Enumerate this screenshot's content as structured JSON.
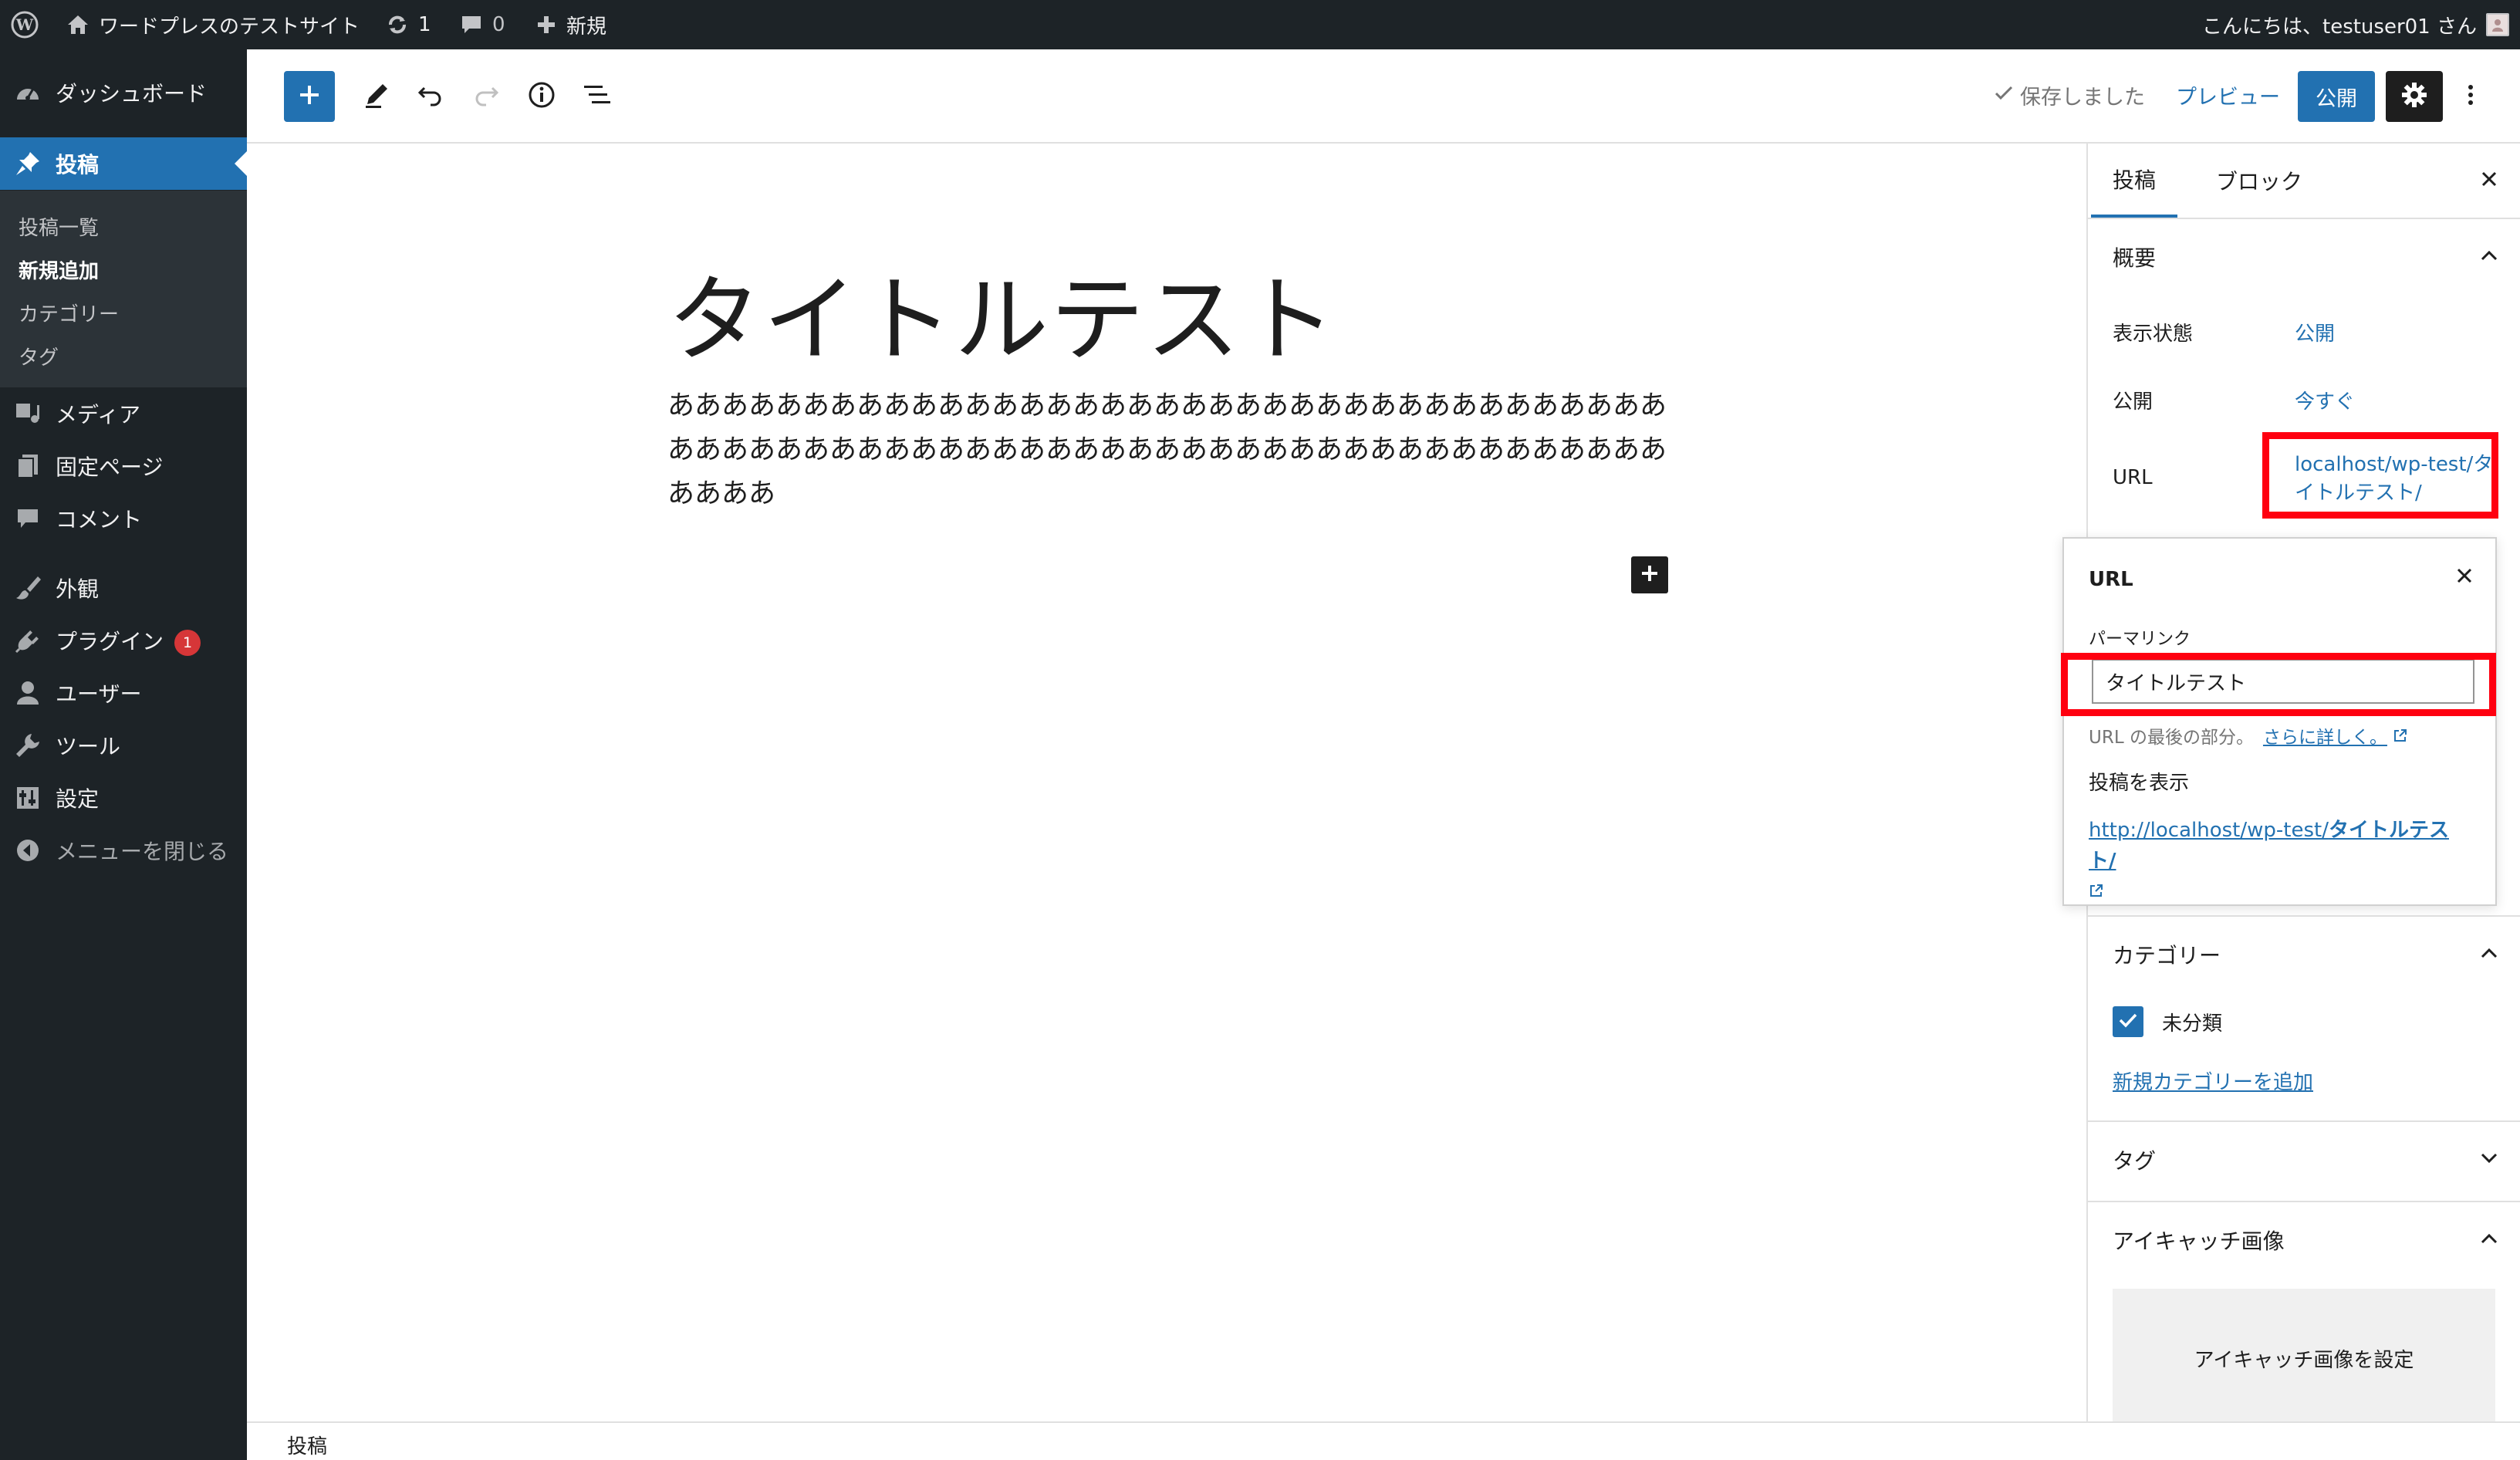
{
  "admin_bar": {
    "site_name": "ワードプレスのテストサイト",
    "updates_count": "1",
    "comments_count": "0",
    "new_label": "新規",
    "greeting": "こんにちは、testuser01 さん"
  },
  "sidebar": {
    "items": [
      {
        "label": "ダッシュボード",
        "icon": "dashboard-icon"
      },
      {
        "label": "投稿",
        "icon": "pushpin-icon",
        "current": true
      },
      {
        "label": "メディア",
        "icon": "media-icon"
      },
      {
        "label": "固定ページ",
        "icon": "page-icon"
      },
      {
        "label": "コメント",
        "icon": "comment-icon"
      },
      {
        "label": "外観",
        "icon": "brush-icon"
      },
      {
        "label": "プラグイン",
        "icon": "plugin-icon",
        "badge": "1"
      },
      {
        "label": "ユーザー",
        "icon": "user-icon"
      },
      {
        "label": "ツール",
        "icon": "wrench-icon"
      },
      {
        "label": "設定",
        "icon": "settings-sliders-icon"
      },
      {
        "label": "メニューを閉じる",
        "icon": "collapse-icon"
      }
    ],
    "submenu": [
      {
        "label": "投稿一覧"
      },
      {
        "label": "新規追加",
        "active": true
      },
      {
        "label": "カテゴリー"
      },
      {
        "label": "タグ"
      }
    ]
  },
  "toolbar": {
    "saved_label": "保存しました",
    "preview_label": "プレビュー",
    "publish_label": "公開"
  },
  "editor": {
    "title": "タイトルテスト",
    "body": "ああああああああああああああああああああああああああああああああああああああああああああああああああああああああああああああああああああああああああああああ"
  },
  "settings": {
    "tabs": [
      "投稿",
      "ブロック"
    ],
    "summary": {
      "heading": "概要",
      "visibility_label": "表示状態",
      "visibility_value": "公開",
      "publish_label": "公開",
      "publish_value": "今すぐ",
      "url_label": "URL",
      "url_value": "localhost/wp-test/タイトルテスト/"
    },
    "url_popover": {
      "title": "URL",
      "permalink_label": "パーマリンク",
      "permalink_value": "タイトルテスト",
      "help_text": "URL の最後の部分。",
      "help_link": "さらに詳しく。",
      "view_post_label": "投稿を表示",
      "link_prefix": "http://localhost/wp-test/",
      "link_slug": "タイトルテスト/"
    },
    "categories": {
      "heading": "カテゴリー",
      "items": [
        {
          "label": "未分類",
          "checked": true
        }
      ],
      "add_new": "新規カテゴリーを追加"
    },
    "tags": {
      "heading": "タグ"
    },
    "featured_image": {
      "heading": "アイキャッチ画像",
      "button": "アイキャッチ画像を設定"
    }
  },
  "footer": {
    "breadcrumb": "投稿"
  },
  "colors": {
    "admin_dark": "#1d2327",
    "accent": "#2271b1",
    "highlight_box": "#ff0010",
    "badge": "#d63638"
  }
}
